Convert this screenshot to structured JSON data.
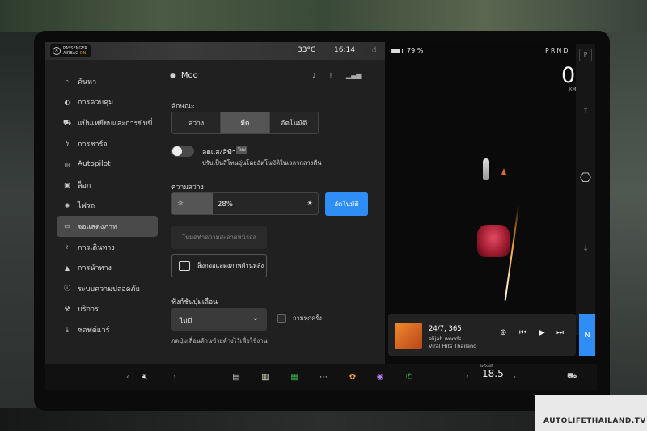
{
  "status_bar": {
    "airbag_line1": "PASSENGER",
    "airbag_line2": "AIRBAG",
    "airbag_state": "ON",
    "temperature": "33°C",
    "time": "16:14"
  },
  "nav": {
    "items": [
      {
        "label": "ค้นหา",
        "icon": "search-icon"
      },
      {
        "label": "การควบคุม",
        "icon": "toggle-icon"
      },
      {
        "label": "แป้นเหยียบและการขับขี่",
        "icon": "car-icon"
      },
      {
        "label": "การชาร์จ",
        "icon": "bolt-icon"
      },
      {
        "label": "Autopilot",
        "icon": "steering-icon"
      },
      {
        "label": "ล็อก",
        "icon": "lock-icon"
      },
      {
        "label": "ไฟรถ",
        "icon": "light-icon"
      },
      {
        "label": "จอแสดงภาพ",
        "icon": "display-icon",
        "active": true
      },
      {
        "label": "การเดินทาง",
        "icon": "trip-icon"
      },
      {
        "label": "การนำทาง",
        "icon": "navigation-icon"
      },
      {
        "label": "ระบบความปลอดภัย",
        "icon": "safety-icon"
      },
      {
        "label": "บริการ",
        "icon": "wrench-icon"
      },
      {
        "label": "ซอฟต์แวร์",
        "icon": "download-icon"
      }
    ]
  },
  "panel": {
    "user_name": "Moo",
    "appearance_label": "ลักษณะ",
    "appearance_options": [
      "สว่าง",
      "มืด",
      "อัตโนมัติ"
    ],
    "appearance_selected": "มืด",
    "bluelight_title": "ลดแสงสีฟ้า",
    "bluelight_badge": "ใหม่",
    "bluelight_desc": "ปรับเป็นสีโทนอุ่นโดยอัตโนมัติในเวลากลางคืน",
    "bluelight_on": false,
    "brightness_label": "ความสว่าง",
    "brightness_value": "28%",
    "brightness_fraction": 0.28,
    "auto_label": "อัตโนมัติ",
    "clean_mode_label": "โหมดทำความสะอาดหน้าจอ",
    "lock_rear_label": "ล็อกจอแสดงภาพด้านหลัง",
    "scroll_wheel_label": "ฟังก์ชันปุ่มเลื่อน",
    "scroll_wheel_value": "ไม่มี",
    "every_time_label": "ถามทุกครั้ง",
    "scroll_hint": "กดปุ่มเลื่อนด้านซ้ายค้างไว้เพื่อใช้งาน"
  },
  "drive": {
    "battery": "79 %",
    "battery_fraction": 0.79,
    "prnd": "PRND",
    "speed": "0",
    "speed_unit": "KM/H",
    "gear_p": "P",
    "gear": "N"
  },
  "media": {
    "song": "24/7, 365",
    "artist": "elijah woods",
    "playlist": "Viral Hits Thailand"
  },
  "dock": {
    "climate_label": "อัตโนมัติ",
    "climate_temp": "18.5"
  },
  "watermark": "AUTOLIFETHAILAND.TV",
  "colors": {
    "accent_blue": "#2f8ef5",
    "airbag_on": "#f39c2a",
    "car_red": "#c8283f"
  }
}
